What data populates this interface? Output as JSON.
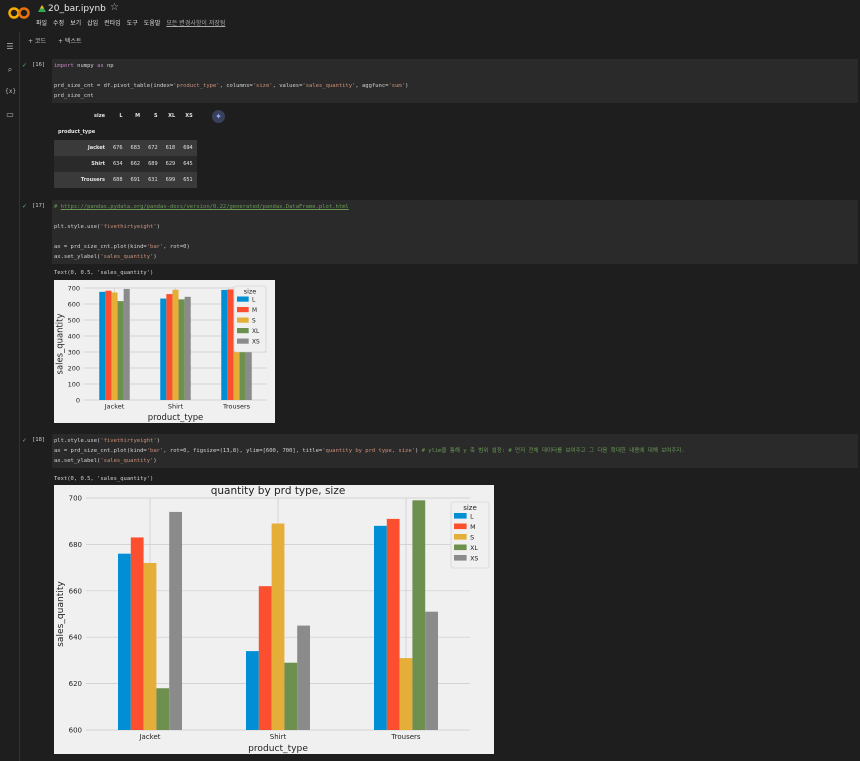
{
  "app": {
    "title": "20_bar.ipynb",
    "menu": [
      "파일",
      "수정",
      "보기",
      "삽입",
      "런타임",
      "도구",
      "도움말"
    ],
    "saved_status": "모든 변경사항이 저장됨"
  },
  "toolbar": {
    "add_code": "+ 코드",
    "add_text": "+ 텍스트"
  },
  "cells": [
    {
      "num": "[16]",
      "lines": [
        [
          {
            "t": "import",
            "c": "kw"
          },
          {
            "t": " numpy "
          },
          {
            "t": "as",
            "c": "kw"
          },
          {
            "t": " np"
          }
        ],
        [],
        [
          {
            "t": "prd_size_cnt = df.pivot_table(index="
          },
          {
            "t": "'product_type'",
            "c": "str"
          },
          {
            "t": ", columns="
          },
          {
            "t": "'size'",
            "c": "str"
          },
          {
            "t": ", values="
          },
          {
            "t": "'sales_quantity'",
            "c": "str"
          },
          {
            "t": ", aggfunc="
          },
          {
            "t": "'sum'",
            "c": "str"
          },
          {
            "t": ")"
          }
        ],
        [
          {
            "t": "prd_size_cnt"
          }
        ]
      ]
    },
    {
      "num": "[17]",
      "lines": [
        [
          {
            "t": "# ",
            "c": "cm"
          },
          {
            "t": "https://pandas.pydata.org/pandas-docs/version/0.22/generated/pandas.DataFrame.plot.html",
            "c": "lnk"
          }
        ],
        [],
        [
          {
            "t": "plt.style.use("
          },
          {
            "t": "'fivethirtyeight'",
            "c": "str"
          },
          {
            "t": ")"
          }
        ],
        [],
        [
          {
            "t": "ax = prd_size_cnt.plot(kind="
          },
          {
            "t": "'bar'",
            "c": "str"
          },
          {
            "t": ", rot=0)"
          }
        ],
        [
          {
            "t": "ax.set_ylabel("
          },
          {
            "t": "'sales_quantity'",
            "c": "str"
          },
          {
            "t": ")"
          }
        ]
      ]
    },
    {
      "num": "[18]",
      "lines": [
        [
          {
            "t": "plt.style.use("
          },
          {
            "t": "'fivethirtyeight'",
            "c": "str"
          },
          {
            "t": ")"
          }
        ],
        [
          {
            "t": "ax = prd_size_cnt.plot(kind="
          },
          {
            "t": "'bar'",
            "c": "str"
          },
          {
            "t": ", rot=0, figsize=(13,8), ylim=[600, 700], title="
          },
          {
            "t": "'quantity by prd type, size'",
            "c": "str"
          },
          {
            "t": ") "
          },
          {
            "t": "# ylim을 통해 y 축 범위 설정: # 먼저 전체 데이터를 보여주고 그 다음 확대한 내용에 대해 보여주자.",
            "c": "cm"
          }
        ],
        [
          {
            "t": "ax.set_ylabel("
          },
          {
            "t": "'sales_quantity'",
            "c": "str"
          },
          {
            "t": ")"
          }
        ]
      ]
    }
  ],
  "outputs": {
    "text17": "Text(0, 0.5, 'sales_quantity')",
    "text18": "Text(0, 0.5, 'sales_quantity')"
  },
  "table": {
    "columns_label": "size",
    "columns": [
      "L",
      "M",
      "S",
      "XL",
      "XS"
    ],
    "index_label": "product_type",
    "rows": [
      {
        "name": "Jacket",
        "values": [
          676,
          683,
          672,
          618,
          694
        ]
      },
      {
        "name": "Shirt",
        "values": [
          634,
          662,
          689,
          629,
          645
        ]
      },
      {
        "name": "Trousers",
        "values": [
          688,
          691,
          631,
          699,
          651
        ]
      }
    ]
  },
  "chart_data": [
    {
      "type": "bar",
      "title": "",
      "categories": [
        "Jacket",
        "Shirt",
        "Trousers"
      ],
      "xlabel": "product_type",
      "ylabel": "sales_quantity",
      "ylim": [
        0,
        700
      ],
      "yticks": [
        0,
        100,
        200,
        300,
        400,
        500,
        600,
        700
      ],
      "legend_title": "size",
      "legend_position": "top-right",
      "series": [
        {
          "name": "L",
          "values": [
            676,
            634,
            688
          ]
        },
        {
          "name": "M",
          "values": [
            683,
            662,
            691
          ]
        },
        {
          "name": "S",
          "values": [
            672,
            689,
            631
          ]
        },
        {
          "name": "XL",
          "values": [
            618,
            629,
            699
          ]
        },
        {
          "name": "XS",
          "values": [
            694,
            645,
            651
          ]
        }
      ]
    },
    {
      "type": "bar",
      "title": "quantity by prd type, size",
      "categories": [
        "Jacket",
        "Shirt",
        "Trousers"
      ],
      "xlabel": "product_type",
      "ylabel": "sales_quantity",
      "ylim": [
        600,
        700
      ],
      "yticks": [
        600,
        620,
        640,
        660,
        680,
        700
      ],
      "legend_title": "size",
      "legend_position": "top-right",
      "series": [
        {
          "name": "L",
          "values": [
            676,
            634,
            688
          ]
        },
        {
          "name": "M",
          "values": [
            683,
            662,
            691
          ]
        },
        {
          "name": "S",
          "values": [
            672,
            689,
            631
          ]
        },
        {
          "name": "XL",
          "values": [
            618,
            629,
            699
          ]
        },
        {
          "name": "XS",
          "values": [
            694,
            645,
            651
          ]
        }
      ]
    }
  ],
  "colors": {
    "L": "#008fd5",
    "M": "#fc4f30",
    "S": "#e5ae38",
    "XL": "#6d904f",
    "XS": "#8b8b8b"
  }
}
